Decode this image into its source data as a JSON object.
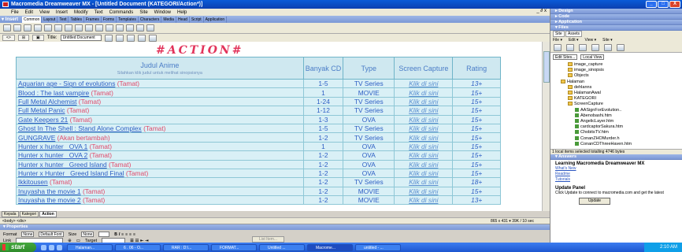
{
  "window": {
    "title": "Macromedia Dreamweaver MX - [Untitled Document (KATEGORI/Action*)]",
    "buttons": [
      "_",
      "□",
      "X"
    ]
  },
  "menubar": {
    "items": [
      "File",
      "Edit",
      "View",
      "Insert",
      "Modify",
      "Text",
      "Commands",
      "Site",
      "Window",
      "Help"
    ],
    "mdi": "_ ∂ x"
  },
  "insertbar": {
    "label": "▾ Insert",
    "tabs": [
      "Common",
      "Layout",
      "Text",
      "Tables",
      "Frames",
      "Forms",
      "Templates",
      "Characters",
      "Media",
      "Head",
      "Script",
      "Application"
    ]
  },
  "doctoolbar": {
    "btn_code": "<>",
    "btn_split": "⊞",
    "btn_design": "▣",
    "title_label": "Title:",
    "title_value": "Untitled Document"
  },
  "page": {
    "heading": "#ACTION#",
    "headers": {
      "title": "Judul Anime",
      "title_sub": "Silahkan klik judul untuk melihat sinopsisnya",
      "cd": "Banyak CD",
      "type": "Type",
      "capture": "Screen Capture",
      "rating": "Rating"
    },
    "rows": [
      {
        "title": "Aquarian age - Sign of evolutions",
        "status": "(Tamat)",
        "cd": "1-5",
        "type": "TV Series",
        "capture": "Klik di sini",
        "rating": "13+"
      },
      {
        "title": "Blood : The last vampire",
        "status": "(Tamat)",
        "cd": "1",
        "type": "MOVIE",
        "capture": "Klik di sini",
        "rating": "15+"
      },
      {
        "title": "Full Metal Alchemist",
        "status": "(Tamat)",
        "cd": "1-24",
        "type": "TV Series",
        "capture": "Klik di sini",
        "rating": "15+"
      },
      {
        "title": "Full Metal Panic",
        "status": "(Tamat)",
        "cd": "1-12",
        "type": "TV Series",
        "capture": "Klik di sini",
        "rating": "15+"
      },
      {
        "title": "Gate Keepers 21",
        "status": "(Tamat)",
        "cd": "1-3",
        "type": "OVA",
        "capture": "Klik di sini",
        "rating": "15+"
      },
      {
        "title": "Ghost In The Shell : Stand Alone Complex",
        "status": "(Tamat)",
        "cd": "1-5",
        "type": "TV Series",
        "capture": "Klik di sini",
        "rating": "15+"
      },
      {
        "title": "GUNGRAVE",
        "status": "(Akan bertambah)",
        "cd": "1-2",
        "type": "TV Series",
        "capture": "Klik di sini",
        "rating": "15+"
      },
      {
        "title": "Hunter x hunter _OVA 1",
        "status": "(Tamat)",
        "cd": "1",
        "type": "OVA",
        "capture": "Klik di sini",
        "rating": "15+"
      },
      {
        "title": "Hunter x hunter _OVA 2",
        "status": "(Tamat)",
        "cd": "1-2",
        "type": "OVA",
        "capture": "Klik di sini",
        "rating": "15+"
      },
      {
        "title": "Hunter x hunter _Greed Island",
        "status": "(Tamat)",
        "cd": "1-2",
        "type": "OVA",
        "capture": "Klik di sini",
        "rating": "15+"
      },
      {
        "title": "Hunter x Hunter _Greed Island Final",
        "status": "(Tamat)",
        "cd": "1-2",
        "type": "OVA",
        "capture": "Klik di sini",
        "rating": "15+"
      },
      {
        "title": "Ikkitousen",
        "status": "(Tamat)",
        "cd": "1-2",
        "type": "TV Series",
        "capture": "Klik di sini",
        "rating": "18+"
      },
      {
        "title": "Inuyasha the movie 1",
        "status": "(Tamat)",
        "cd": "1-2",
        "type": "MOVIE",
        "capture": "Klik di sini",
        "rating": "15+"
      },
      {
        "title": "Inuyasha the movie 2",
        "status": "(Tamat)",
        "cd": "1-2",
        "type": "MOVIE",
        "capture": "Klik di sini",
        "rating": "13+"
      }
    ]
  },
  "doctabs": [
    "Kepala",
    "Kategori",
    "Action"
  ],
  "tagselector": {
    "path": "<body> <div>",
    "size": "865 x 431 ▾  39K / 10 sec"
  },
  "properties": {
    "header": "▾ Properties",
    "format_label": "Format",
    "format_value": "None",
    "font_value": "Default Font",
    "size_label": "Size",
    "size_value": "None",
    "link_label": "Link",
    "target_label": "Target",
    "list_item": "List Item..."
  },
  "panels": {
    "design": "▸ Design",
    "code": "▸ Code",
    "application": "▸ Application",
    "files": "▾ Files",
    "files_tabs": [
      "Site",
      "Assets"
    ],
    "files_menu": [
      "File ▾",
      "Edit ▾",
      "View ▾",
      "Site ▾"
    ],
    "site_select": "Edit Sites...",
    "view_select": "Local View",
    "tree": [
      {
        "label": "image_capture",
        "depth": 2,
        "kind": "folder"
      },
      {
        "label": "image_sinopsis",
        "depth": 2,
        "kind": "folder"
      },
      {
        "label": "Objects",
        "depth": 2,
        "kind": "folder"
      },
      {
        "label": "Halaman",
        "depth": 1,
        "kind": "folder"
      },
      {
        "label": "dehlanns",
        "depth": 2,
        "kind": "folder"
      },
      {
        "label": "HalamanAwal",
        "depth": 2,
        "kind": "folder"
      },
      {
        "label": "KATEGORI",
        "depth": 2,
        "kind": "folder"
      },
      {
        "label": "ScreenCapture",
        "depth": 2,
        "kind": "folder"
      },
      {
        "label": "AASignForEvolution..",
        "depth": 3,
        "kind": "file"
      },
      {
        "label": "Abenobashi.htm",
        "depth": 3,
        "kind": "file"
      },
      {
        "label": "AngelicLayer.htm",
        "depth": 3,
        "kind": "file"
      },
      {
        "label": "cardcaptorSakura.htm",
        "depth": 3,
        "kind": "file"
      },
      {
        "label": "ChobitsTV.htm",
        "depth": 3,
        "kind": "file"
      },
      {
        "label": "ConanZHOMurder.h",
        "depth": 3,
        "kind": "file"
      },
      {
        "label": "ConanCDThreeHaven.htm",
        "depth": 3,
        "kind": "file"
      }
    ],
    "local_info": "1 local items selected totalling 4746 bytes",
    "answers_header": "▾ Answers",
    "answers_title": "Learning Macromedia Dreamweaver MX",
    "answers_links": [
      "What's New",
      "Readme",
      "Tutorials"
    ],
    "update_title": "Update Panel",
    "update_text": "Click Update to connect to macromedia.com and get the latest",
    "update_button": "Update"
  },
  "taskbar": {
    "start": "start",
    "tasks": [
      "Halaman...",
      "6 . 06 - O...",
      "RAR : D:\\...",
      "FORMAT...",
      "Untitled ...",
      "Macrome...",
      "untitled - ..."
    ],
    "clock": "2:10 AM"
  }
}
